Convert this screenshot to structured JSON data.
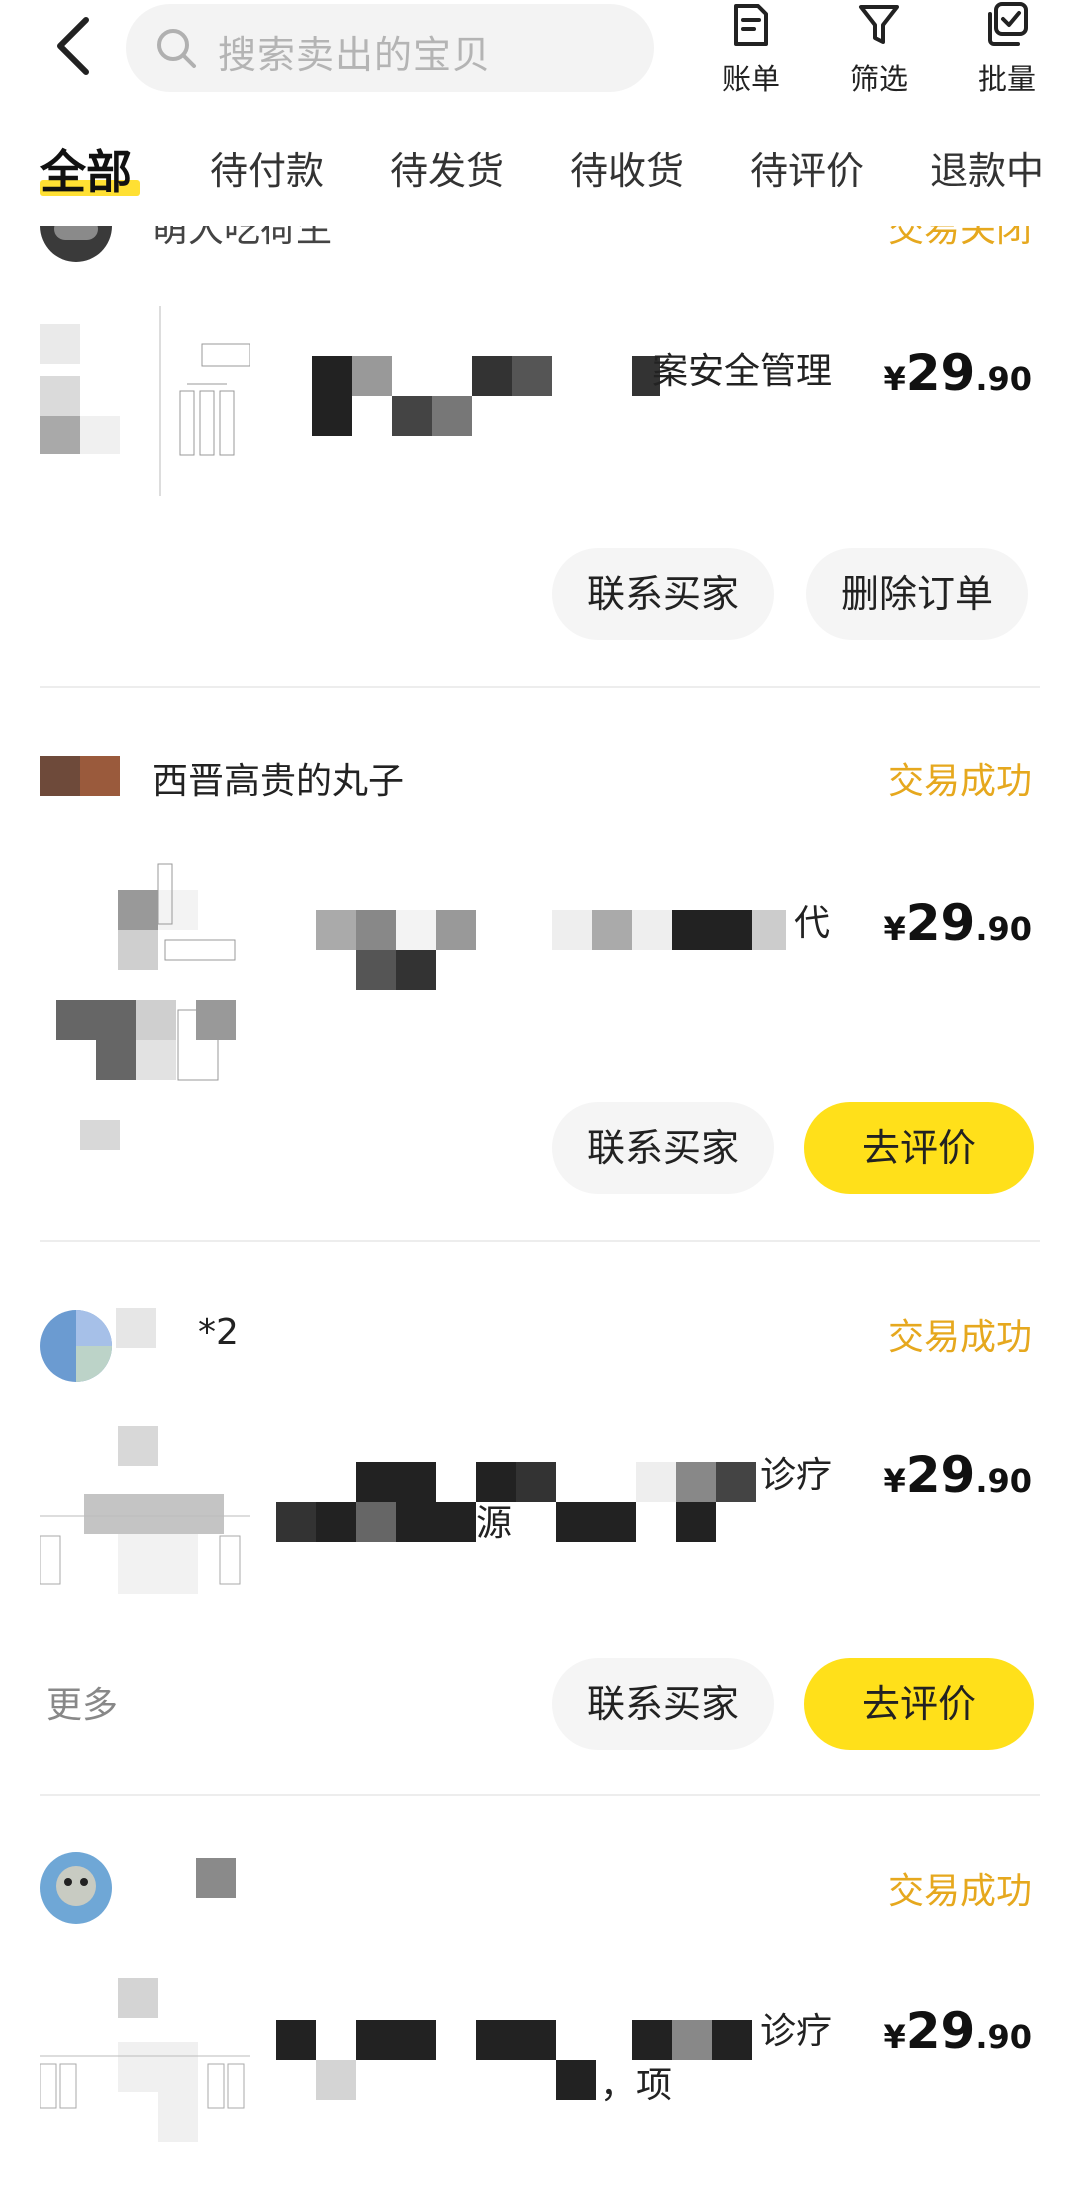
{
  "header": {
    "search_placeholder": "搜索卖出的宝贝",
    "actions": [
      {
        "label": "账单",
        "icon": "bill-icon"
      },
      {
        "label": "筛选",
        "icon": "filter-icon"
      },
      {
        "label": "批量",
        "icon": "batch-icon"
      }
    ]
  },
  "tabs": [
    {
      "label": "全部",
      "active": true
    },
    {
      "label": "待付款",
      "active": false
    },
    {
      "label": "待发货",
      "active": false
    },
    {
      "label": "待收货",
      "active": false
    },
    {
      "label": "待评价",
      "active": false
    },
    {
      "label": "退款中",
      "active": false
    }
  ],
  "colors": {
    "accent_yellow": "#ffe01a",
    "status_orange": "#e6a81e"
  },
  "orders": [
    {
      "buyer": "萌大吃荷生",
      "status": "交易关闭",
      "title": "案安全管理",
      "price_currency": "¥",
      "price_int": "29",
      "price_dec": ".90",
      "buttons": [
        "联系买家",
        "删除订单"
      ]
    },
    {
      "buyer": "西晋高贵的丸子",
      "status": "交易成功",
      "title": "代",
      "price_currency": "¥",
      "price_int": "29",
      "price_dec": ".90",
      "buttons": [
        "联系买家",
        "去评价"
      ]
    },
    {
      "buyer": "*2",
      "status": "交易成功",
      "title": "诊疗",
      "title_line2": "源",
      "price_currency": "¥",
      "price_int": "29",
      "price_dec": ".90",
      "more": "更多",
      "buttons": [
        "联系买家",
        "去评价"
      ]
    },
    {
      "buyer": "",
      "status": "交易成功",
      "title": "诊疗",
      "title_line2": "，项",
      "price_currency": "¥",
      "price_int": "29",
      "price_dec": ".90"
    }
  ]
}
